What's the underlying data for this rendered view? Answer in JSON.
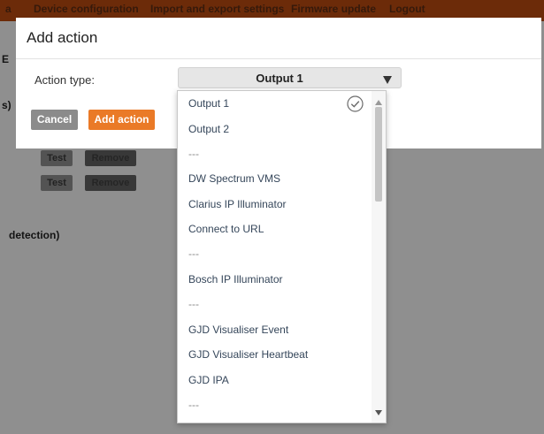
{
  "nav": {
    "items": [
      "a",
      "Device configuration",
      "Import and export settings",
      "Firmware update",
      "Logout"
    ]
  },
  "background_page": {
    "fragments": [
      "E",
      "s)",
      "detection)"
    ],
    "test_label": "Test",
    "remove_label": "Remove"
  },
  "modal": {
    "title": "Add action",
    "action_type_label": "Action type:",
    "selected_value": "Output 1",
    "cancel_label": "Cancel",
    "add_label": "Add action"
  },
  "dropdown": {
    "options": [
      {
        "label": "Output 1",
        "selected": true
      },
      {
        "label": "Output 2"
      },
      {
        "label": "---"
      },
      {
        "label": "DW Spectrum VMS"
      },
      {
        "label": "Clarius IP Illuminator"
      },
      {
        "label": "Connect to URL"
      },
      {
        "label": "---"
      },
      {
        "label": "Bosch IP Illuminator"
      },
      {
        "label": "---"
      },
      {
        "label": "GJD Visualiser Event"
      },
      {
        "label": "GJD Visualiser Heartbeat"
      },
      {
        "label": "GJD IPA"
      },
      {
        "label": "---"
      }
    ]
  },
  "colors": {
    "accent_orange": "#ea7a27",
    "nav_bar": "#b4490f",
    "cancel_gray": "#8b8b8b",
    "option_text": "#35465a"
  },
  "icons": {
    "select_arrow": "triangle-down-icon",
    "selected_check": "check-circle-icon",
    "scroll_up": "scroll-up-arrow-icon",
    "scroll_down": "scroll-down-arrow-icon"
  }
}
